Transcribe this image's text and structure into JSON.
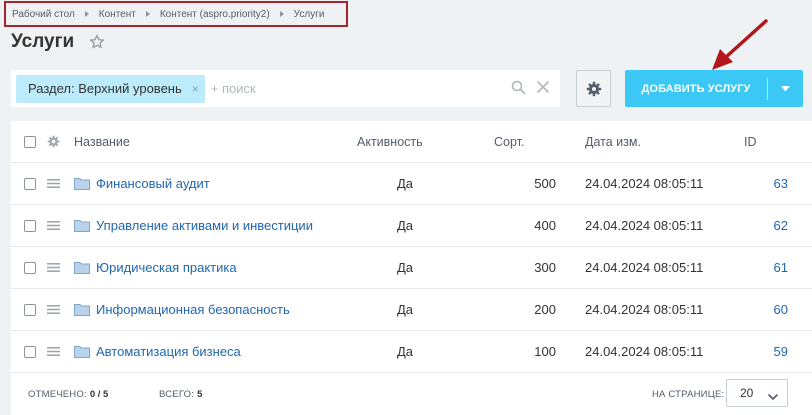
{
  "breadcrumb": [
    "Рабочий стол",
    "Контент",
    "Контент (aspro.priority2)",
    "Услуги"
  ],
  "page": {
    "title": "Услуги"
  },
  "filter": {
    "chip_label": "Раздел: Верхний уровень",
    "chip_close": "×",
    "search_placeholder": "+ поиск"
  },
  "toolbar": {
    "add_label": "ДОБАВИТЬ УСЛУГУ"
  },
  "table": {
    "headers": {
      "name": "Название",
      "active": "Активность",
      "sort": "Сорт.",
      "date": "Дата изм.",
      "id": "ID"
    },
    "rows": [
      {
        "name": "Финансовый аудит",
        "active": "Да",
        "sort": "500",
        "date": "24.04.2024 08:05:11",
        "id": "63"
      },
      {
        "name": "Управление активами и инвестиции",
        "active": "Да",
        "sort": "400",
        "date": "24.04.2024 08:05:11",
        "id": "62"
      },
      {
        "name": "Юридическая практика",
        "active": "Да",
        "sort": "300",
        "date": "24.04.2024 08:05:11",
        "id": "61"
      },
      {
        "name": "Информационная безопасность",
        "active": "Да",
        "sort": "200",
        "date": "24.04.2024 08:05:11",
        "id": "60"
      },
      {
        "name": "Автоматизация бизнеса",
        "active": "Да",
        "sort": "100",
        "date": "24.04.2024 08:05:11",
        "id": "59"
      }
    ]
  },
  "footer": {
    "selected_label": "ОТМЕЧЕНО:",
    "selected_value": "0 / 5",
    "total_label": "ВСЕГО:",
    "total_value": "5",
    "per_page_label": "НА СТРАНИЦЕ:",
    "per_page_value": "20"
  },
  "colors": {
    "accent": "#3bc8f5",
    "link": "#2067b0",
    "chip": "#bcecfb",
    "highlight_border": "#a8242b",
    "annotation_arrow": "#b3171d"
  },
  "icons": [
    "star-icon",
    "search-icon",
    "clear-icon",
    "gear-icon",
    "chevron-down-icon",
    "drag-handle-icon",
    "folder-icon",
    "arrow-annotation-icon"
  ]
}
